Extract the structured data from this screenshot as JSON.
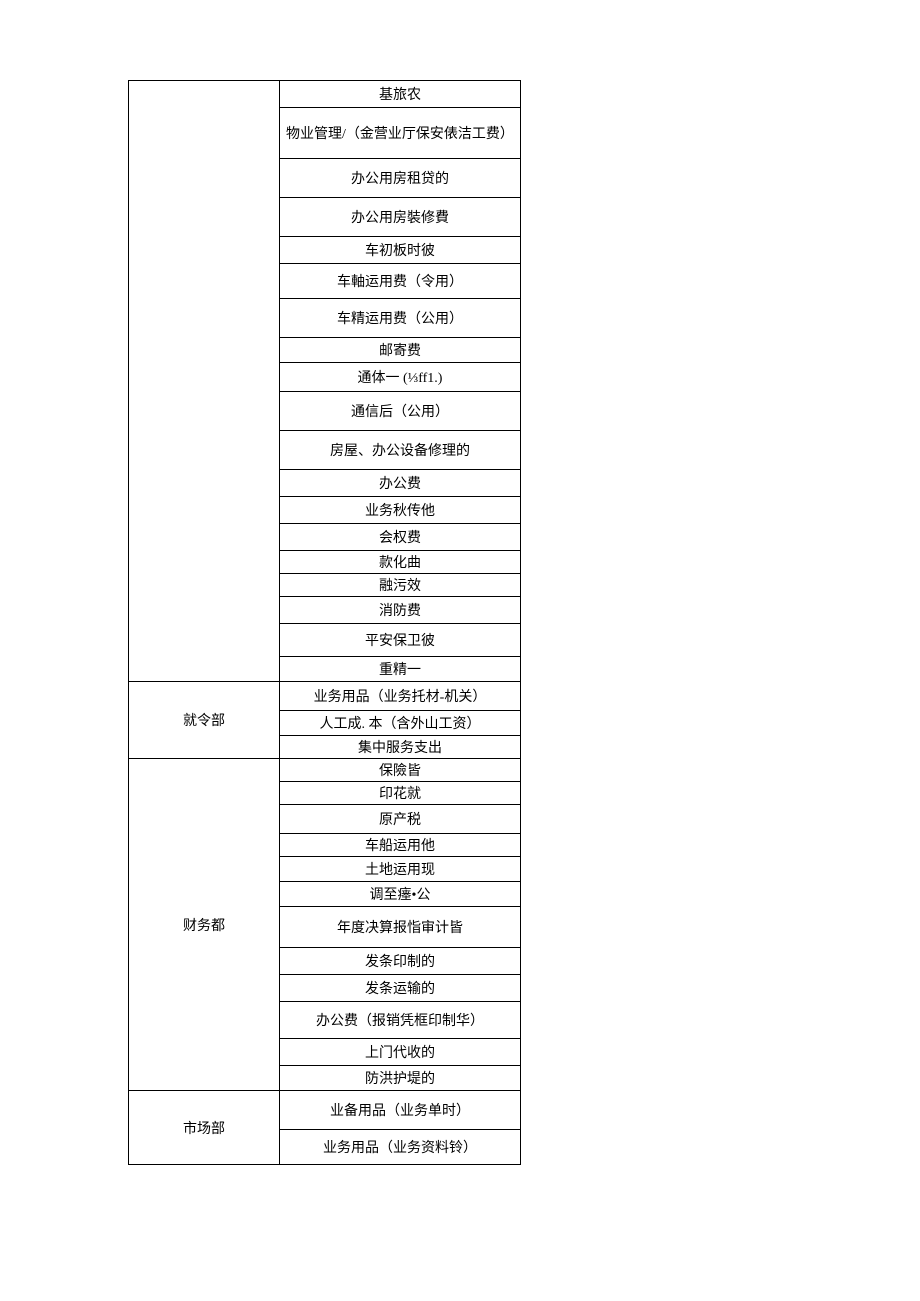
{
  "groups": [
    {
      "label": "",
      "items": [
        "基旅农",
        "物业管理/（金营业厅保安俵洁工费）",
        "办公用房租贷的",
        "办公用房裝修費",
        "车初板时彼",
        "车軸运用费（令用）",
        "车精运用费（公用）",
        "邮寄费",
        "通体一 (⅓ff1.)",
        "通信后（公用）",
        "房屋、办公设备修理的",
        "办公费",
        "业务秋传他",
        "会权费",
        "款化曲",
        "融污效",
        "消防费",
        "平安保卫彼",
        "重精一"
      ],
      "heights": [
        26,
        50,
        38,
        38,
        26,
        34,
        38,
        24,
        28,
        38,
        38,
        26,
        26,
        26,
        22,
        22,
        26,
        32,
        24
      ]
    },
    {
      "label": "就令部",
      "items": [
        "业务用品（业务托材-机关）",
        "人工成. 本（含外山工资）",
        "集中服务支出"
      ],
      "heights": [
        28,
        24,
        22
      ]
    },
    {
      "label": "财务都",
      "items": [
        "保險皆",
        "印花就",
        "原产税",
        "车船运用他",
        "土地运用现",
        "调至瘗•公",
        "年度决算报恉审计皆",
        "发条印制的",
        "发条运输的",
        "办公费（报销凭框印制华）",
        "上门代收的",
        "防洪护堤的"
      ],
      "heights": [
        22,
        22,
        28,
        22,
        24,
        24,
        40,
        26,
        26,
        36,
        26,
        24
      ]
    },
    {
      "label": "市场部",
      "items": [
        "业备用品（业务单时）",
        "业务用品（业务资料铃）"
      ],
      "heights": [
        38,
        34
      ]
    }
  ]
}
